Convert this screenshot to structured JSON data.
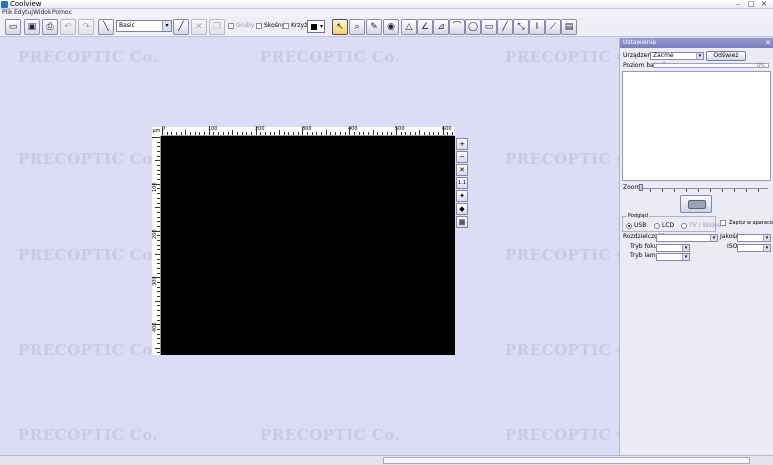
{
  "window": {
    "title": "Coolview",
    "controls": {
      "minimize": "–",
      "maximize": "□",
      "close": "✕"
    }
  },
  "menu": [
    "Plik",
    "Edytuj",
    "Widok",
    "Pomoc"
  ],
  "toolbar": {
    "font_value": "Basic",
    "check_bold": "Gruby",
    "check_italic": "Skośny",
    "check_cross": "Krzyż",
    "icons": {
      "new": "new-icon",
      "save": "save-icon",
      "print": "print-icon",
      "undo": "undo-icon",
      "redo": "redo-icon",
      "pen": "pen-icon",
      "pointer": "pointer-icon",
      "zoom": "zoom-icon",
      "eye": "eye-icon",
      "triangle": "triangle-icon",
      "ellipse": "ellipse-icon",
      "rect": "rect-icon",
      "line": "line-icon",
      "text": "text-icon",
      "clip": "clip-icon"
    }
  },
  "ruler": {
    "corner_label": "μm",
    "top": [
      "0",
      "100",
      "200",
      "300",
      "400",
      "500",
      "600"
    ],
    "left": [
      "100",
      "200",
      "300",
      "400"
    ]
  },
  "watermark": "PRECOPTIC Co.",
  "panel": {
    "title": "Ustawienia",
    "close": "✕",
    "device_label": "Urządzenie",
    "device_value": "Zacme",
    "refresh_button": "Odśwież",
    "battery_label": "Poziom baterii",
    "battery_value": "0%",
    "zoom_label": "Zoom",
    "connection_legend": "Podgląd",
    "radio_usb": "USB",
    "radio_lcd": "LCD",
    "radio_tv": "TV / Wideo",
    "save_to_camera": "Zapisz w aparacie",
    "resolution_label": "Rozdzielczość",
    "quality_label": "Jakość",
    "focus_label": "Tryb fokusa",
    "iso_label": "ISO",
    "lamp_label": "Tryb lampy"
  },
  "colors": {
    "background": "#dcdcf4",
    "panel_header": "#8686c6",
    "canvas": "#000000"
  }
}
